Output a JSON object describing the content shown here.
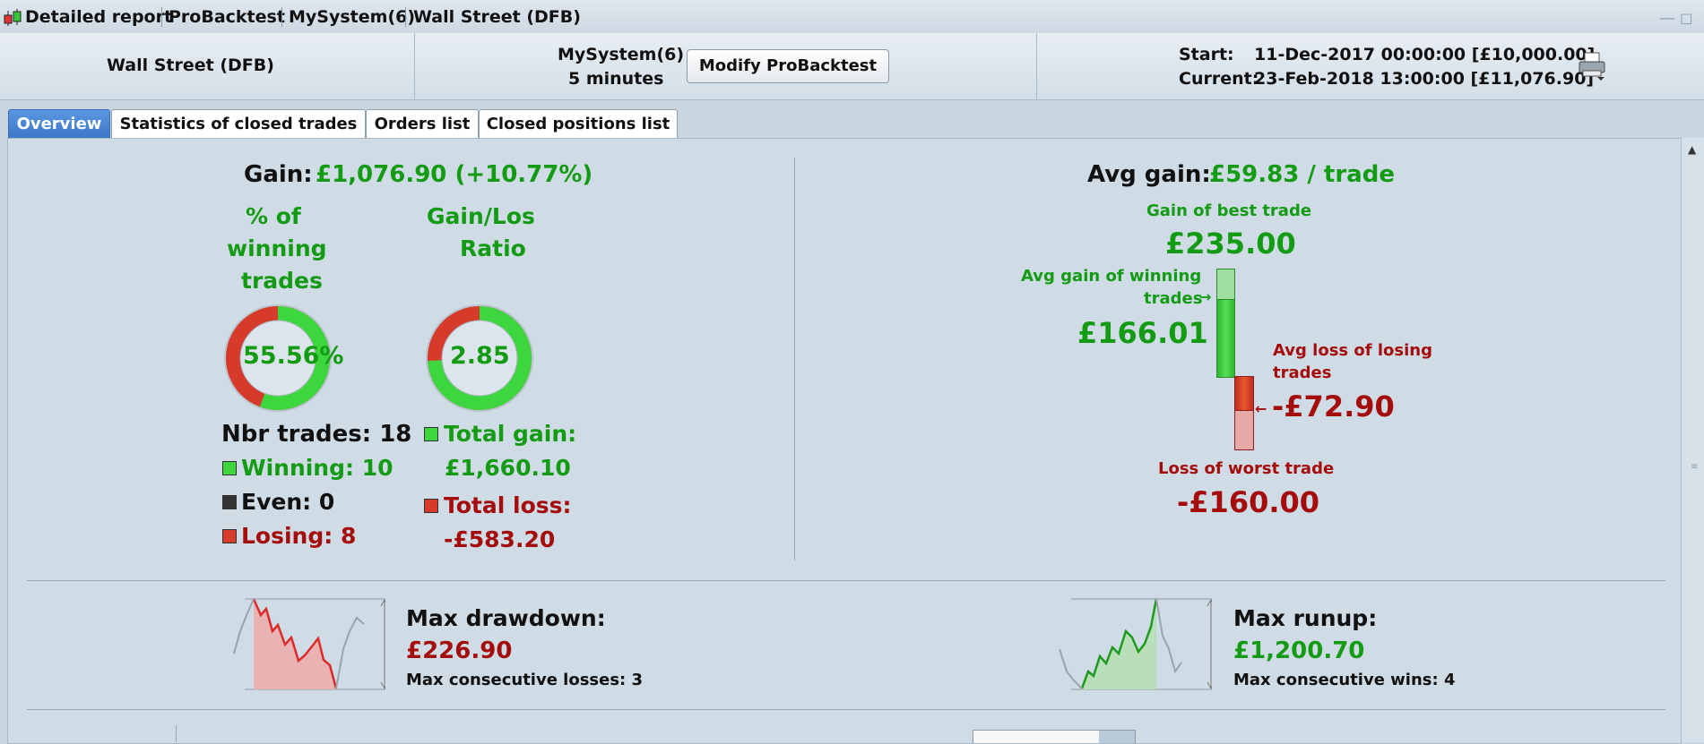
{
  "titlebar": {
    "items": [
      "Detailed report",
      "ProBacktest",
      "MySystem(6)",
      "Wall Street (DFB)"
    ]
  },
  "header": {
    "instrument": "Wall Street (DFB)",
    "system_name": "MySystem(6)",
    "timeframe": "5 minutes",
    "modify_button": "Modify ProBacktest",
    "start_label": "Start:",
    "start_value": "11-Dec-2017 00:00:00 [£10,000.00]",
    "current_label": "Current:",
    "current_value": "23-Feb-2018 13:00:00 [£11,076.90]"
  },
  "tabs": [
    {
      "label": "Overview",
      "active": true
    },
    {
      "label": "Statistics of closed trades",
      "active": false
    },
    {
      "label": "Orders list",
      "active": false
    },
    {
      "label": "Closed positions list",
      "active": false
    }
  ],
  "overview": {
    "gain_label": "Gain:",
    "gain_value": "£1,076.90 (+10.77%)",
    "pct_winning_title": [
      "% of",
      "winning",
      "trades"
    ],
    "pct_winning_value": "55.56%",
    "pct_winning_fraction": 0.5556,
    "gain_loss_title": [
      "Gain/Los",
      "Ratio"
    ],
    "gain_loss_value": "2.85",
    "gain_loss_fraction": 0.74,
    "nbr_trades": "Nbr trades: 18",
    "winning": "Winning: 10",
    "even": "Even: 0",
    "losing": "Losing: 8",
    "total_gain_label": "Total gain:",
    "total_gain_value": "£1,660.10",
    "total_loss_label": "Total loss:",
    "total_loss_value": "-£583.20",
    "avg_gain_label": "Avg gain:",
    "avg_gain_value": "£59.83 / trade",
    "best_trade_label": "Gain of best trade",
    "best_trade_value": "£235.00",
    "avg_win_label": [
      "Avg gain of winning",
      "trades"
    ],
    "avg_win_value": "£166.01",
    "avg_loss_label": [
      "Avg loss of losing",
      "trades"
    ],
    "avg_loss_value": "-£72.90",
    "worst_trade_label": "Loss of worst trade",
    "worst_trade_value": "-£160.00",
    "max_drawdown_label": "Max drawdown:",
    "max_drawdown_value": "£226.90",
    "max_consec_losses": "Max consecutive losses: 3",
    "max_runup_label": "Max runup:",
    "max_runup_value": "£1,200.70",
    "max_consec_wins": "Max consecutive wins: 4"
  },
  "colors": {
    "gain_green": "#149b14",
    "loss_red": "#a50d0d",
    "active_tab": "#3b76c8"
  },
  "icons": {
    "app": "candlestick-icon",
    "print": "printer-icon"
  }
}
